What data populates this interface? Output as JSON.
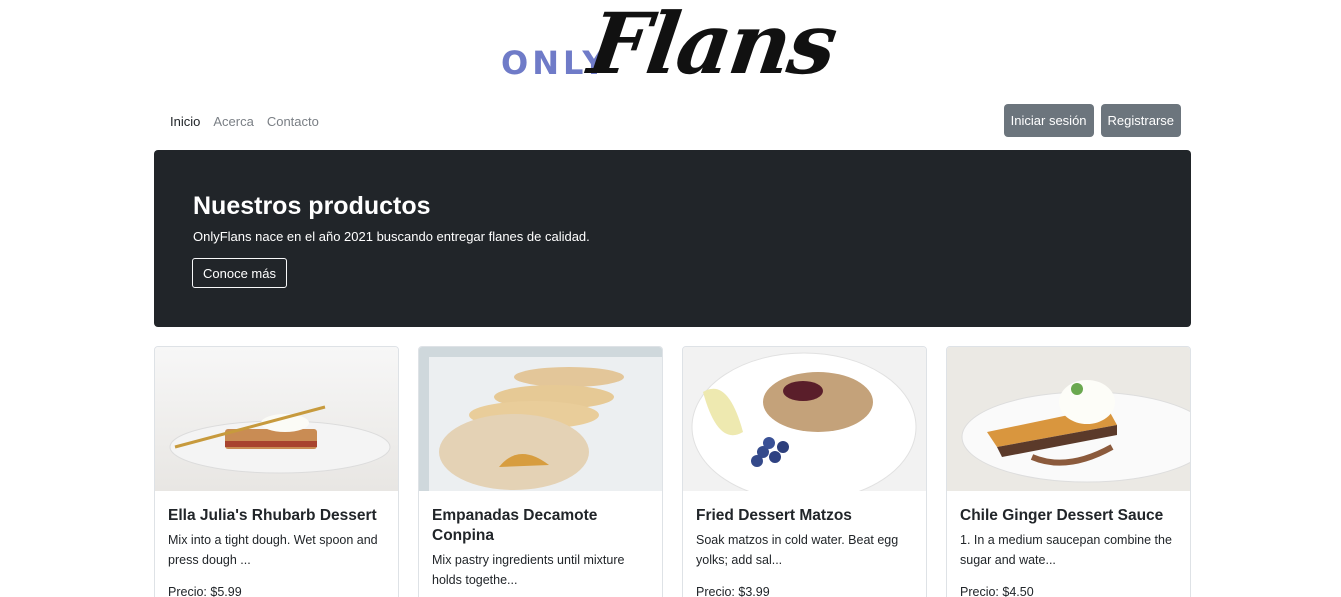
{
  "logo": {
    "only": "ONLY",
    "flans": "Flans"
  },
  "nav": {
    "links": [
      "Inicio",
      "Acerca",
      "Contacto"
    ],
    "login": "Iniciar sesión",
    "register": "Registrarse"
  },
  "hero": {
    "title": "Nuestros productos",
    "text": "OnlyFlans nace en el año 2021 buscando entregar flanes de calidad.",
    "button": "Conoce más"
  },
  "products": [
    {
      "title": "Ella Julia's Rhubarb Dessert",
      "description": "Mix into a tight dough. Wet spoon and press dough ...",
      "price": "Precio: $5.99"
    },
    {
      "title": "Empanadas Decamote Conpina",
      "description": "Mix pastry ingredients until mixture holds togethe...",
      "price": ""
    },
    {
      "title": "Fried Dessert Matzos",
      "description": "Soak matzos in cold water. Beat egg yolks; add sal...",
      "price": "Precio: $3.99"
    },
    {
      "title": "Chile Ginger Dessert Sauce",
      "description": "1. In a medium saucepan combine the sugar and wate...",
      "price": "Precio: $4.50"
    }
  ]
}
